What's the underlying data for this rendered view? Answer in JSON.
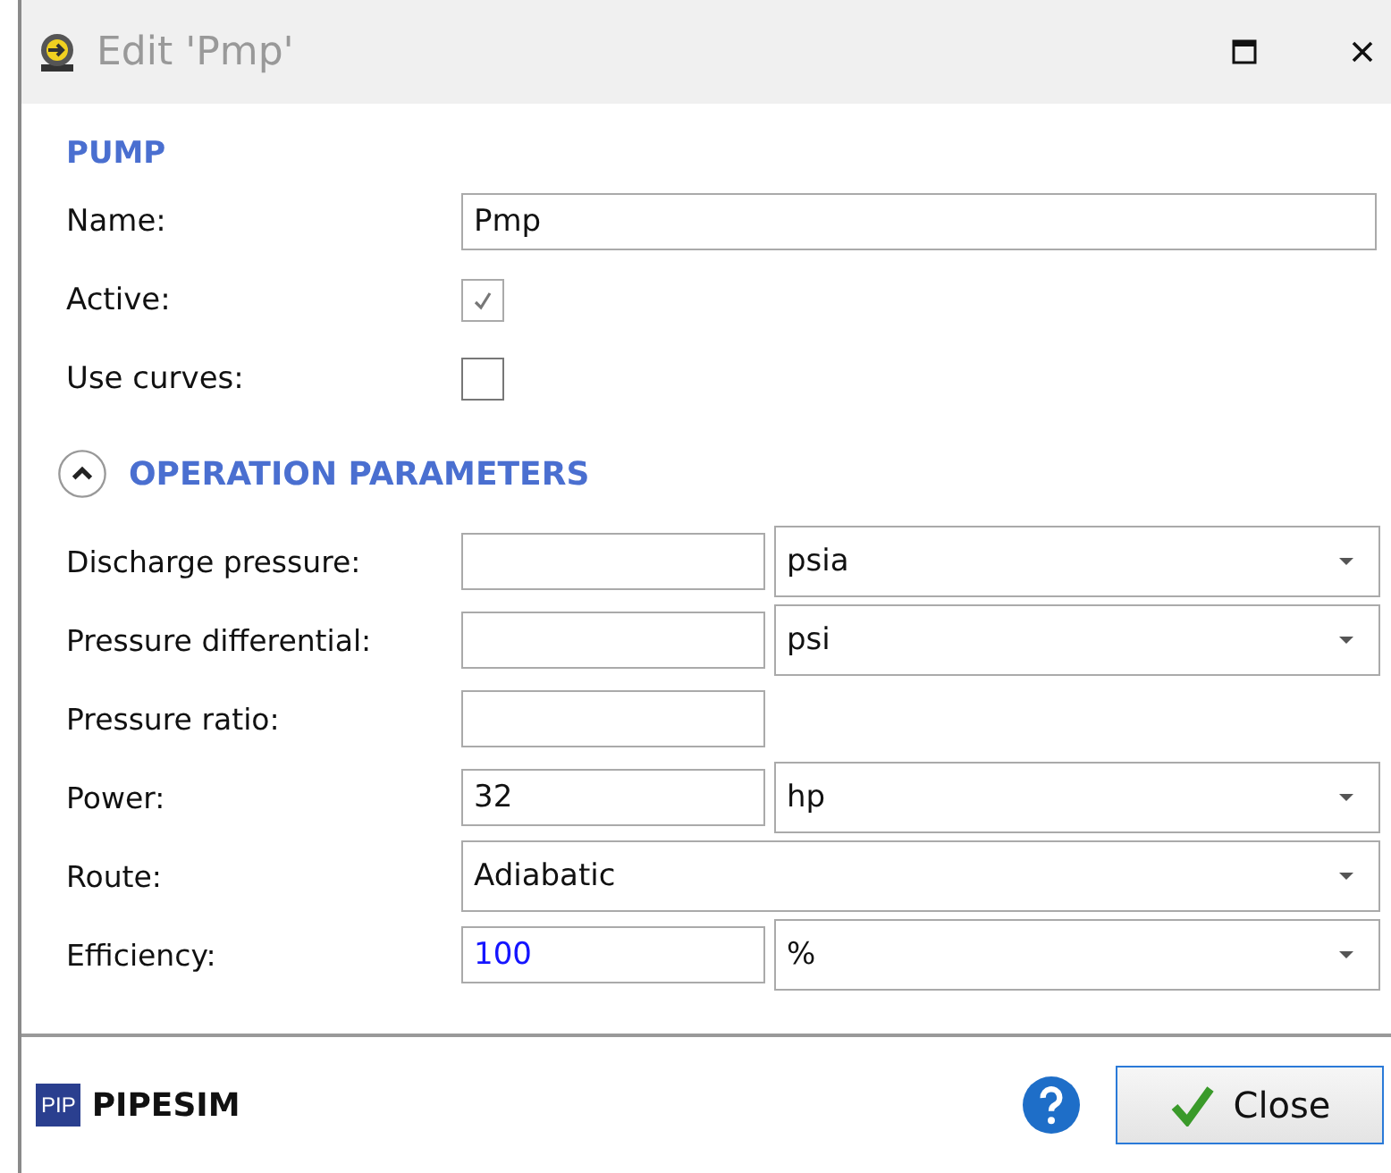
{
  "window": {
    "title": "Edit 'Pmp'"
  },
  "pump": {
    "heading": "PUMP",
    "rows": [
      {
        "kind": "text",
        "label": "Name:",
        "value": "Pmp"
      },
      {
        "kind": "checkbox",
        "label": "Active:",
        "checked": true,
        "disabled": true
      },
      {
        "kind": "checkbox",
        "label": "Use curves:",
        "checked": false,
        "disabled": false
      }
    ]
  },
  "operation": {
    "heading": "OPERATION PARAMETERS",
    "expanded": true,
    "rows": [
      {
        "kind": "value_unit",
        "label": "Discharge pressure:",
        "value": "",
        "unit": "psia",
        "is_default": false
      },
      {
        "kind": "value_unit",
        "label": "Pressure differential:",
        "value": "",
        "unit": "psi",
        "is_default": false
      },
      {
        "kind": "value",
        "label": "Pressure ratio:",
        "value": "",
        "is_default": false
      },
      {
        "kind": "value_unit",
        "label": "Power:",
        "value": "32",
        "unit": "hp",
        "is_default": false
      },
      {
        "kind": "select",
        "label": "Route:",
        "value": "Adiabatic"
      },
      {
        "kind": "value_unit",
        "label": "Efficiency:",
        "value": "100",
        "unit": "%",
        "is_default": true
      }
    ]
  },
  "footer": {
    "logo_badge": "PIP",
    "logo_text": "PIPESIM",
    "close_button": "Close"
  }
}
